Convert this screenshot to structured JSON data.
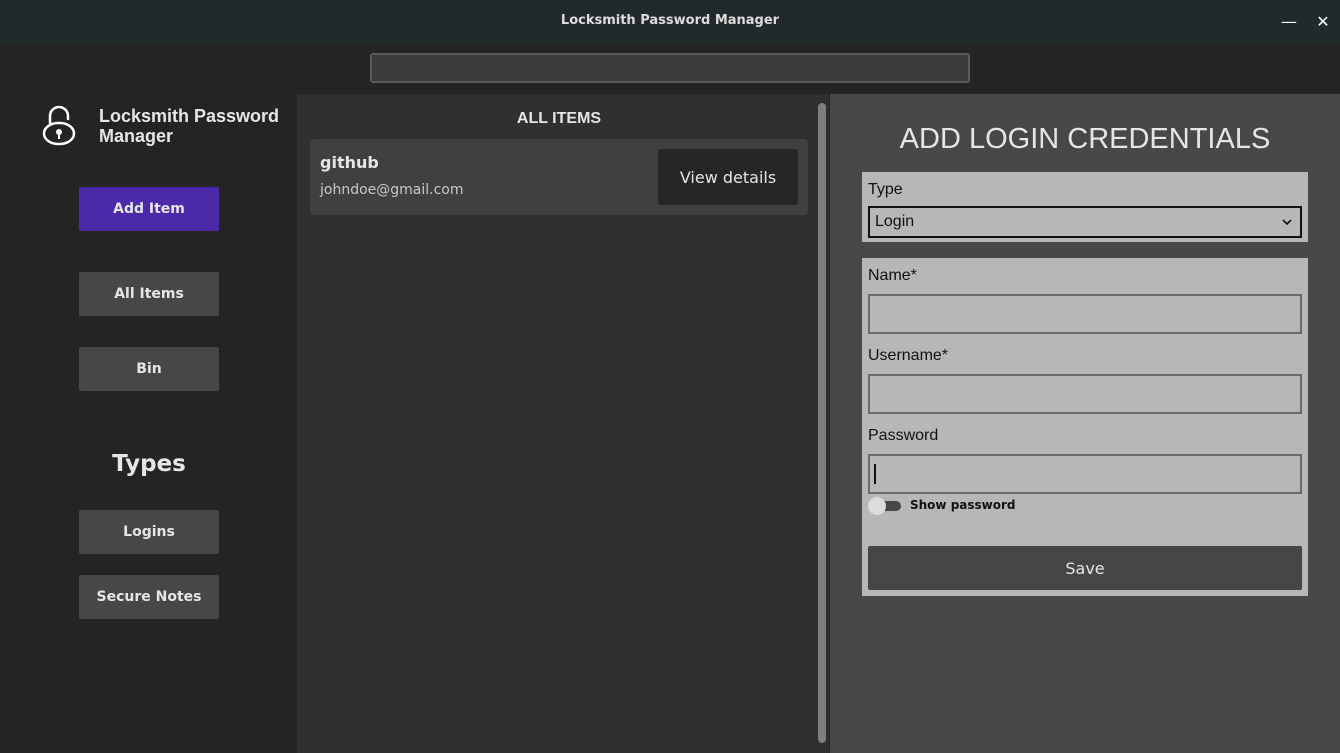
{
  "window": {
    "title": "Locksmith Password Manager",
    "minimize_glyph": "—",
    "close_glyph": "✕"
  },
  "search": {
    "value": "",
    "placeholder": ""
  },
  "sidebar": {
    "app_name": "Locksmith Password Manager",
    "buttons": {
      "add_item": "Add Item",
      "all_items": "All Items",
      "bin": "Bin"
    },
    "types_heading": "Types",
    "types": {
      "logins": "Logins",
      "secure_notes": "Secure Notes"
    }
  },
  "list": {
    "heading": "ALL ITEMS",
    "items": [
      {
        "name": "github",
        "username": "johndoe@gmail.com",
        "action": "View details"
      }
    ]
  },
  "form": {
    "title": "ADD LOGIN CREDENTIALS",
    "type_label": "Type",
    "type_value": "Login",
    "name_label": "Name*",
    "name_value": "",
    "username_label": "Username*",
    "username_value": "",
    "password_label": "Password",
    "password_value": "",
    "show_password_label": "Show password",
    "show_password_on": false,
    "save_label": "Save"
  },
  "colors": {
    "accent": "#4a2aa8",
    "titlebar": "#20292c",
    "sidebar_bg": "#242424",
    "list_bg": "#303030",
    "form_bg": "#484848",
    "form_box": "#b7b7b7"
  }
}
